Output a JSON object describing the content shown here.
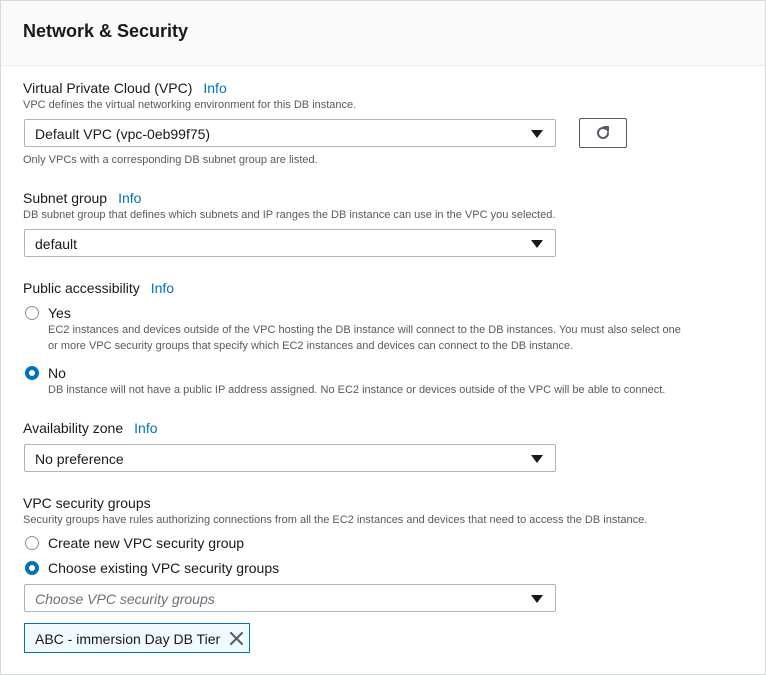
{
  "section": {
    "title": "Network & Security"
  },
  "vpc": {
    "label": "Virtual Private Cloud (VPC)",
    "info": "Info",
    "description": "VPC defines the virtual networking environment for this DB instance.",
    "selected": "Default VPC (vpc-0eb99f75)",
    "hint": "Only VPCs with a corresponding DB subnet group are listed.",
    "refresh_icon": "refresh-icon"
  },
  "subnet": {
    "label": "Subnet group",
    "info": "Info",
    "description": "DB subnet group that defines which subnets and IP ranges the DB instance can use in the VPC you selected.",
    "selected": "default"
  },
  "public_access": {
    "label": "Public accessibility",
    "info": "Info",
    "options": [
      {
        "label": "Yes",
        "checked": false,
        "desc_line1": "EC2 instances and devices outside of the VPC hosting the DB instance will connect to the DB instances. You must also select one",
        "desc_line2": "or more VPC security groups that specify which EC2 instances and devices can connect to the DB instance."
      },
      {
        "label": "No",
        "checked": true,
        "desc_line1": "DB instance will not have a public IP address assigned. No EC2 instance or devices outside of the VPC will be able to connect."
      }
    ]
  },
  "availability_zone": {
    "label": "Availability zone",
    "info": "Info",
    "selected": "No preference"
  },
  "security_groups": {
    "label": "VPC security groups",
    "description": "Security groups have rules authorizing connections from all the EC2 instances and devices that need to access the DB instance.",
    "options": [
      {
        "label": "Create new VPC security group",
        "checked": false
      },
      {
        "label": "Choose existing VPC security groups",
        "checked": true
      }
    ],
    "placeholder": "Choose VPC security groups",
    "tokens": [
      "ABC - immersion Day DB Tier"
    ]
  },
  "colors": {
    "accent": "#0073bb",
    "text": "#16191f",
    "muted": "#545b64",
    "border": "#aab7b8"
  }
}
